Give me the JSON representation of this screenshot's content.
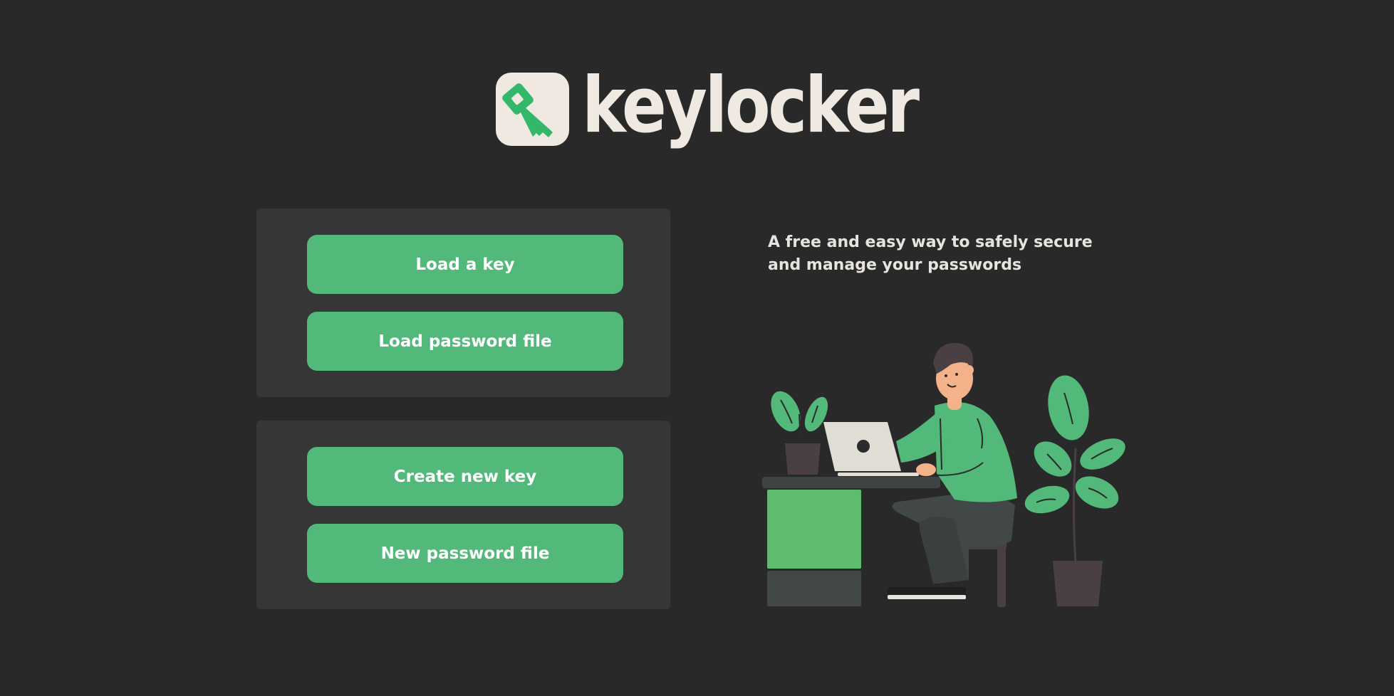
{
  "app": {
    "name": "keylocker",
    "logo_icon": "key-icon"
  },
  "colors": {
    "background": "#292929",
    "panel": "#363636",
    "accent": "#52b97a",
    "logo_bg": "#efe9e2",
    "text_light": "#e7e3de"
  },
  "load_panel": {
    "load_key_label": "Load a key",
    "load_file_label": "Load password file"
  },
  "create_panel": {
    "create_key_label": "Create new key",
    "new_file_label": "New password file"
  },
  "tagline": {
    "line1": "A free and easy way to safely secure",
    "line2": "and manage your passwords"
  },
  "illustration": {
    "name": "person-at-laptop-illustration"
  }
}
